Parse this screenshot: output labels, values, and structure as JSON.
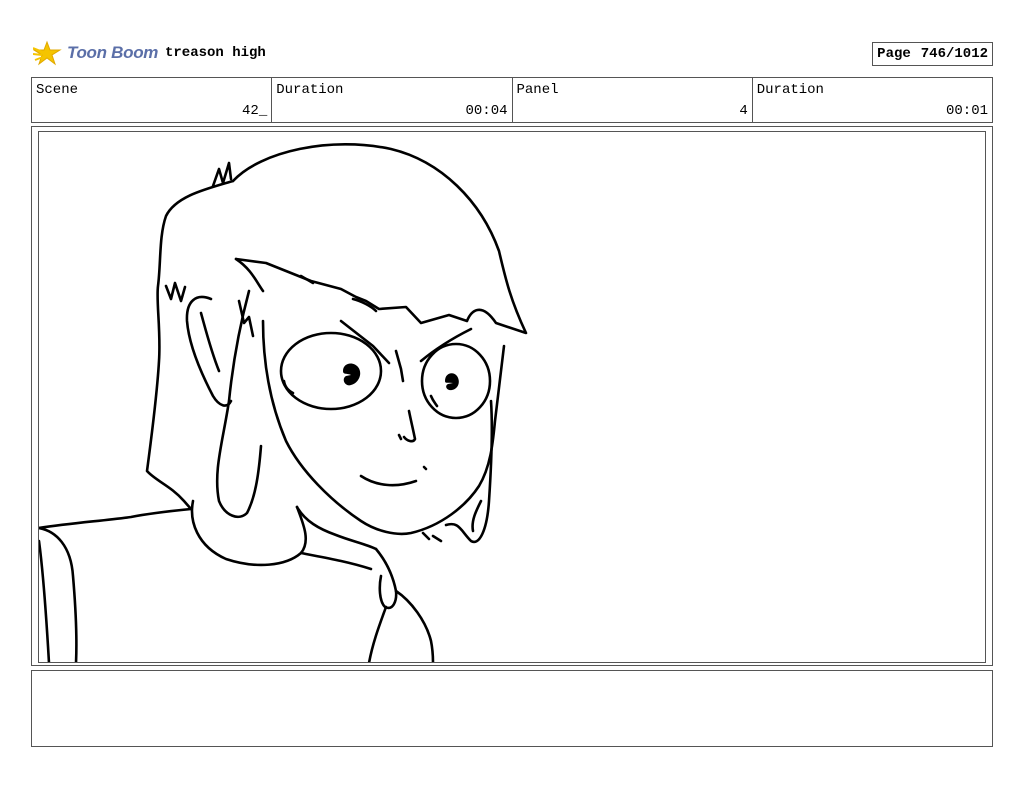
{
  "header": {
    "logo_text": "Toon Boom",
    "project_title": "treason high",
    "page_label": "Page",
    "page_number": "746/1012"
  },
  "info": {
    "scene_label": "Scene",
    "scene_value": "42_",
    "scene_duration_label": "Duration",
    "scene_duration_value": "00:04",
    "panel_label": "Panel",
    "panel_value": "4",
    "panel_duration_label": "Duration",
    "panel_duration_value": "00:01"
  },
  "notes": {
    "text": ""
  }
}
